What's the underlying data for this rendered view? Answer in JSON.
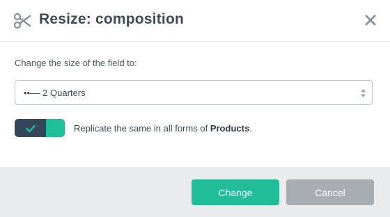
{
  "dialog": {
    "title": "Resize: composition",
    "header_icon": "scissors-icon",
    "close_icon": "close-icon"
  },
  "form": {
    "field_label": "Change the size of the field to:",
    "size_select": {
      "selected_value": "••–– 2 Quarters",
      "arrow_icon": "sort-arrows-icon"
    },
    "replicate_toggle": {
      "checked": true,
      "check_icon": "check-icon",
      "text_prefix": "Replicate the same in all forms of",
      "text_strong": "Products",
      "text_suffix": "."
    }
  },
  "footer": {
    "change_label": "Change",
    "cancel_label": "Cancel"
  },
  "colors": {
    "primary": "#20bd98",
    "toggle_dark": "#34475a",
    "cancel": "#a8adb2",
    "footer_bg": "#eaebed",
    "title_text": "#3e4a58"
  }
}
